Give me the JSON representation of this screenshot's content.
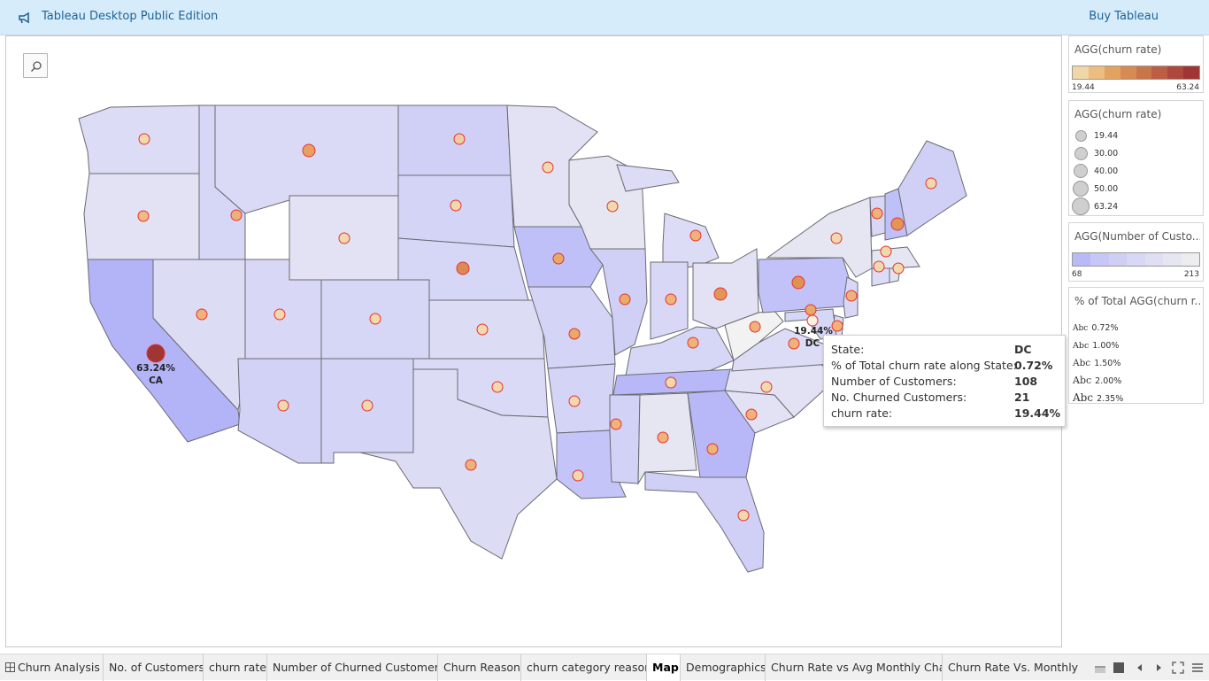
{
  "app": {
    "title": "Tableau Desktop Public Edition",
    "buy_label": "Buy Tableau"
  },
  "legends": {
    "color_churn": {
      "title": "AGG(churn rate)",
      "min": "19.44",
      "max": "63.24",
      "colors": [
        "#f0d7a8",
        "#ecbc80",
        "#e2a260",
        "#d68b55",
        "#c9754a",
        "#bc5e43",
        "#ae483d",
        "#a03535"
      ]
    },
    "size_churn": {
      "title": "AGG(churn rate)",
      "entries": [
        "19.44",
        "30.00",
        "40.00",
        "50.00",
        "63.24"
      ]
    },
    "color_customers": {
      "title": "AGG(Number of Custo...",
      "min": "68",
      "max": "213",
      "colors": [
        "#b9b9f8",
        "#c6c6f7",
        "#cfcff6",
        "#d7d7f6",
        "#dfdff4",
        "#e6e6f2",
        "#ededf0"
      ]
    },
    "label_share": {
      "title": "% of Total AGG(churn r...",
      "glyph": "Abc",
      "entries": [
        "0.72%",
        "1.00%",
        "1.50%",
        "2.00%",
        "2.35%"
      ]
    }
  },
  "map_labels": {
    "ca": {
      "value": "63.24%",
      "state": "CA"
    },
    "dc": {
      "value": "19.44%",
      "state": "DC"
    }
  },
  "tooltip": {
    "rows": [
      {
        "key": "State:",
        "value": "DC"
      },
      {
        "key": "% of Total churn rate along State:",
        "value": "0.72%"
      },
      {
        "key": "Number of Customers:",
        "value": "108"
      },
      {
        "key": "No. Churned Customers:",
        "value": "21"
      },
      {
        "key": "churn rate:",
        "value": "19.44%"
      }
    ]
  },
  "tabs": [
    {
      "label": "Churn Analysis"
    },
    {
      "label": "No. of Customers"
    },
    {
      "label": "churn rate"
    },
    {
      "label": "Number of Churned Customers"
    },
    {
      "label": "Churn Reason"
    },
    {
      "label": "churn category reason"
    },
    {
      "label": "Map"
    },
    {
      "label": "Demographics"
    },
    {
      "label": "Churn Rate vs Avg Monthly Char..."
    },
    {
      "label": "Churn Rate Vs. Monthly Dat"
    }
  ],
  "icons": {
    "app": "megaphone-icon",
    "search": "search-icon",
    "dashboard": "dashboard-tab-icon",
    "grid": "grid-view-icon",
    "filmstrip": "filmstrip-icon",
    "prev": "previous-sheet-icon",
    "next": "next-sheet-icon",
    "fullscreen": "fullscreen-icon",
    "menu": "sheet-menu-icon"
  }
}
